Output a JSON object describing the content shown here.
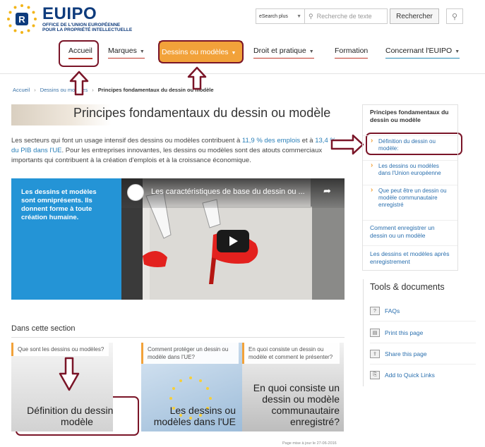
{
  "logo": {
    "name": "EUIPO",
    "sub1": "OFFICE DE L'UNION EUROPÉENNE",
    "sub2": "POUR LA PROPRIÉTÉ INTELLECTUELLE"
  },
  "search": {
    "scope": "eSearch plus",
    "placeholder": "Recherche de texte",
    "button": "Rechercher"
  },
  "nav": {
    "accueil": "Accueil",
    "marques": "Marques",
    "dessins": "Dessins ou modèles",
    "droit": "Droit et pratique",
    "formation": "Formation",
    "concernant": "Concernant l'EUIPO"
  },
  "breadcrumb": {
    "home": "Accueil",
    "section": "Dessins ou modèles",
    "current": "Principes fondamentaux du dessin ou modèle"
  },
  "page_title": "Principes fondamentaux du dessin ou modèle",
  "intro": {
    "part1": "Les secteurs qui font un usage intensif des dessins ou modèles contribuent à ",
    "link1": "11,9 % des emplois",
    "part2": " et à ",
    "link2": "13,4 % du PIB dans l'UE",
    "part3": ". Pour les entreprises innovantes, les dessins ou modèles sont des atouts commerciaux importants qui contribuent à la création d'emplois et à la croissance économique."
  },
  "hero_text": "Les dessins et modèles sont omniprésents. Ils donnent forme à toute création humaine.",
  "video_title": "Les caractéristiques de base du dessin ou ...",
  "section_title": "Dans cette section",
  "cards": [
    {
      "label": "Que sont les dessins ou modèles?",
      "big": "Définition du dessin ou modèle"
    },
    {
      "label": "Comment protéger un dessin ou modèle dans l'UE?",
      "big": "Les dessins ou modèles dans l'UE"
    },
    {
      "label": "En quoi consiste un dessin ou modèle et comment le présenter?",
      "big": "En quoi consiste un dessin ou modèle communautaire enregistré?"
    }
  ],
  "sidebar": {
    "title": "Principes fondamentaux du dessin ou modèle",
    "sub": [
      "Définition du dessin ou modèle:",
      "Les dessins ou modèles dans l'Union européenne",
      "Que peut être un dessin ou modèle communautaire enregistré"
    ],
    "links": [
      "Comment enregistrer un dessin ou un modèle",
      "Les dessins et modèles après enregistrement"
    ]
  },
  "tools": {
    "title": "Tools & documents",
    "items": [
      "FAQs",
      "Print this page",
      "Share this page",
      "Add to Quick Links"
    ]
  },
  "updated": "Page mise à jour le 27-06-2016"
}
